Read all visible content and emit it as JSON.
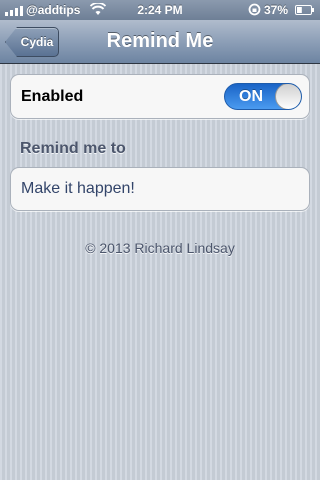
{
  "status_bar": {
    "carrier": "@addtips",
    "time": "2:24 PM",
    "battery_percent": "37%",
    "battery_level": 0.37,
    "icons": [
      "signal-bars-icon",
      "wifi-icon",
      "rotation-lock-icon",
      "battery-icon"
    ]
  },
  "nav": {
    "back_label": "Cydia",
    "title": "Remind Me"
  },
  "settings": {
    "enabled_label": "Enabled",
    "enabled_state": "ON",
    "section_header": "Remind me to",
    "reminder_value": "Make it happen!"
  },
  "footer": {
    "copyright": "© 2013 Richard Lindsay"
  },
  "colors": {
    "toggle_on": "#1a64c6",
    "nav_bar": "#8d9fb7",
    "background": "#cbd2dc",
    "section_text": "#4c566c"
  }
}
